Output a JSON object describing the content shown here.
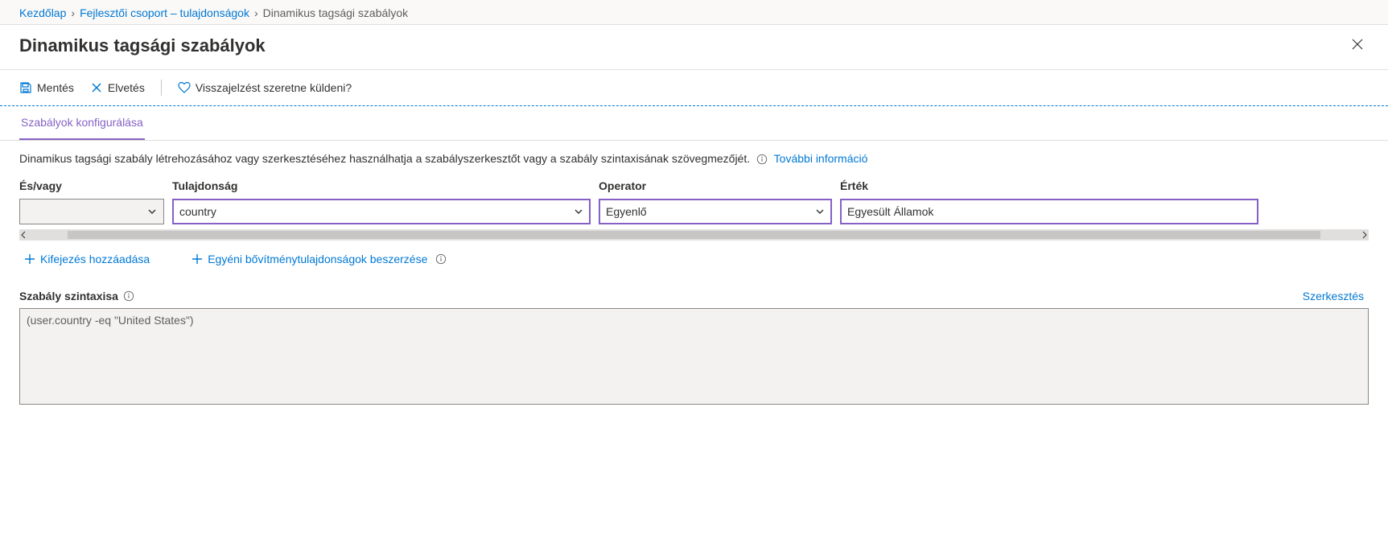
{
  "breadcrumb": {
    "home": "Kezdőlap",
    "group": "Fejlesztői csoport – tulajdonságok",
    "current": "Dinamikus tagsági szabályok"
  },
  "page_title": "Dinamikus tagsági szabályok",
  "toolbar": {
    "save": "Mentés",
    "discard": "Elvetés",
    "feedback": "Visszajelzést szeretne küldeni?"
  },
  "tabs": {
    "configure": "Szabályok konfigurálása"
  },
  "help": {
    "text": "Dinamikus tagsági szabály létrehozásához vagy szerkesztéséhez használhatja a szabályszerkesztőt vagy a szabály szintaxisának szövegmezőjét.",
    "more_info": "További információ"
  },
  "columns": {
    "andor": "És/vagy",
    "property": "Tulajdonság",
    "operator": "Operator",
    "value": "Érték"
  },
  "row": {
    "andor": "",
    "property": "country",
    "operator": "Egyenlő",
    "value": "Egyesült Államok"
  },
  "links": {
    "add_expression": "Kifejezés hozzáadása",
    "custom_ext": "Egyéni bővítménytulajdonságok beszerzése"
  },
  "syntax": {
    "label": "Szabály szintaxisa",
    "edit": "Szerkesztés",
    "text": "(user.country -eq \"United States\")"
  }
}
